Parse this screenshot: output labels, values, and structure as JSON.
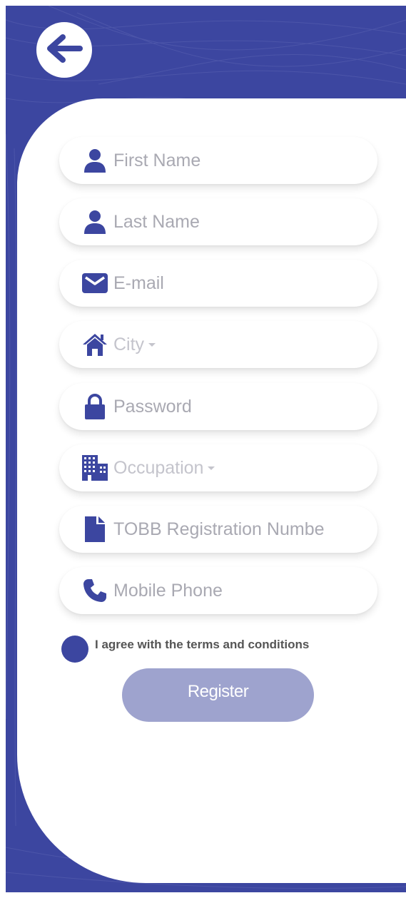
{
  "colors": {
    "brand": "#3c46a0",
    "register_button": "#9ea3ce",
    "placeholder": "#a9a9b2"
  },
  "back_button": {
    "icon": "arrow-left-icon"
  },
  "form": {
    "fields": [
      {
        "icon": "user-icon",
        "placeholder": "First Name"
      },
      {
        "icon": "user-icon",
        "placeholder": "Last Name"
      },
      {
        "icon": "envelope-icon",
        "placeholder": "E-mail"
      },
      {
        "icon": "home-icon",
        "placeholder": "City"
      },
      {
        "icon": "lock-icon",
        "placeholder": "Password"
      },
      {
        "icon": "building-icon",
        "placeholder": "Occupation"
      },
      {
        "icon": "file-icon",
        "placeholder": "TOBB Registration Numbe"
      },
      {
        "icon": "phone-icon",
        "placeholder": "Mobile Phone"
      }
    ],
    "terms_label": "I agree with the terms and conditions",
    "register_label": "Register"
  }
}
